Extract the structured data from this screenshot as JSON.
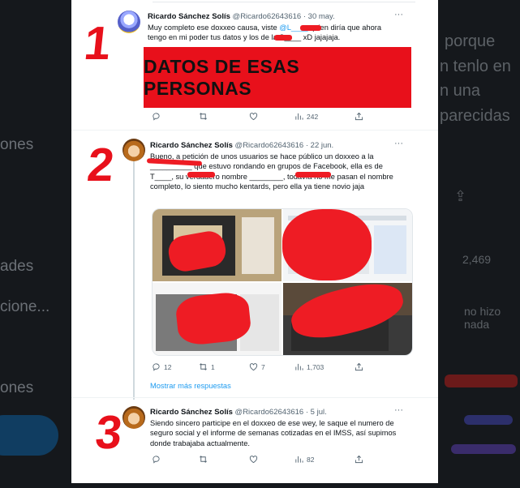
{
  "background": {
    "left_snippets": [
      "ones",
      "ades",
      "cione...",
      "ones"
    ],
    "right_snippets": [
      "porque",
      "n tenlo en",
      "n una",
      "parecidas",
      "2,469",
      "no hizo nada"
    ]
  },
  "annotations": [
    "1",
    "2",
    "3"
  ],
  "tweets": [
    {
      "name": "Ricardo Sánchez Solís",
      "handle": "@Ricardo62643616",
      "sep": "·",
      "date": "30 may.",
      "more": "···",
      "text_a": "Muy completo ese doxxeo causa, viste ",
      "mention": "@L____",
      "text_b": " quien diría que ahora tengo en mi poder tus datos y los de la S____ xD jajajaja.",
      "image_text": "DATOS DE ESAS PERSONAS",
      "views": "242"
    },
    {
      "name": "Ricardo Sánchez Solís",
      "handle": "@Ricardo62643616",
      "sep": "·",
      "date": "22 jun.",
      "more": "···",
      "text": "Bueno, a petición de unos usuarios se hace público un doxxeo a la __________ que estuvo rondando en grupos de Facebook, ella es de T____, su verdadero nombre ________, todavía no me pasan el nombre completo, lo siento mucho kentards, pero ella ya tiene novio jaja",
      "replies": "12",
      "retweets": "1",
      "likes": "7",
      "views": "1,703",
      "show_more": "Mostrar más respuestas"
    },
    {
      "name": "Ricardo Sánchez Solís",
      "handle": "@Ricardo62643616",
      "sep": "·",
      "date": "5 jul.",
      "more": "···",
      "text": "Siendo sincero participe en el doxxeo de ese wey, le saque el numero de seguro social y el informe de semanas cotizadas en el IMSS, así supimos donde trabajaba actualmente.",
      "views": "82"
    }
  ],
  "colors": {
    "link": "#1d9bf0",
    "redaction": "#ee1c24",
    "banner": "#e8101b",
    "muted": "#536471"
  }
}
